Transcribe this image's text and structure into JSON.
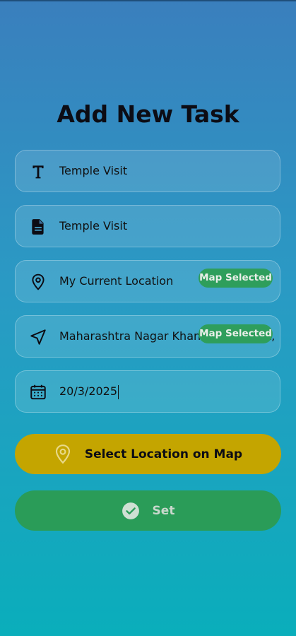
{
  "page": {
    "title": "Add New Task"
  },
  "fields": {
    "title": {
      "value": "Temple Visit",
      "icon": "title-text-icon"
    },
    "description": {
      "value": "Temple Visit",
      "icon": "document-icon"
    },
    "start_location": {
      "value": "My Current Location",
      "icon": "location-pin-icon",
      "badge": "Map Selected"
    },
    "destination": {
      "value": "Maharashtra Nagar Khandoba Market, Kh",
      "icon": "navigation-arrow-icon",
      "badge": "Map Selected"
    },
    "date": {
      "value": "20/3/2025",
      "icon": "calendar-icon"
    }
  },
  "buttons": {
    "select_location": {
      "label": "Select Location on Map",
      "icon": "location-pin-icon"
    },
    "set": {
      "label": "Set",
      "icon": "check-circle-icon"
    }
  },
  "colors": {
    "gradient_top": "#3a7fbd",
    "gradient_bottom": "#0aaebb",
    "map_button": "#c4a500",
    "set_button": "#2a9c58",
    "badge": "#2e9e5c"
  }
}
